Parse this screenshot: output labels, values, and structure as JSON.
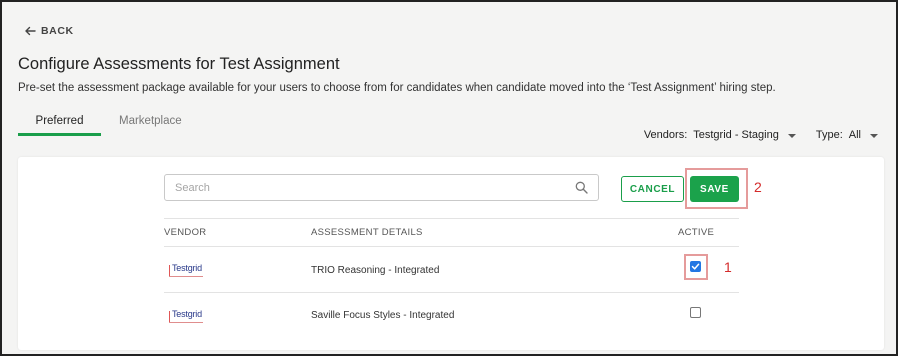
{
  "nav": {
    "back_label": "BACK"
  },
  "header": {
    "title": "Configure Assessments for Test Assignment",
    "description": "Pre-set the assessment package available for your users to choose from for candidates when candidate moved into the ‘Test Assignment’ hiring step."
  },
  "tabs": [
    {
      "label": "Preferred",
      "active": true
    },
    {
      "label": "Marketplace",
      "active": false
    }
  ],
  "filters": {
    "vendors_label": "Vendors:",
    "vendors_value": "Testgrid - Staging",
    "type_label": "Type:",
    "type_value": "All"
  },
  "toolbar": {
    "search_placeholder": "Search",
    "search_value": "",
    "cancel_label": "CANCEL",
    "save_label": "SAVE"
  },
  "table": {
    "columns": [
      "VENDOR",
      "ASSESSMENT DETAILS",
      "ACTIVE"
    ],
    "rows": [
      {
        "vendor": "Testgrid",
        "details": "TRIO Reasoning - Integrated",
        "active": true
      },
      {
        "vendor": "Testgrid",
        "details": "Saville Focus Styles - Integrated",
        "active": false
      }
    ]
  },
  "annotations": {
    "step1": "1",
    "step2": "2"
  },
  "colors": {
    "accent_green": "#1ba24b",
    "checkbox_blue": "#2377e3",
    "annotation_red": "#d42b2b",
    "highlight_border": "#e59b9b"
  },
  "icons": {
    "back": "arrow-left-icon",
    "search": "search-icon",
    "dropdown": "caret-down-icon",
    "check": "check-icon"
  }
}
